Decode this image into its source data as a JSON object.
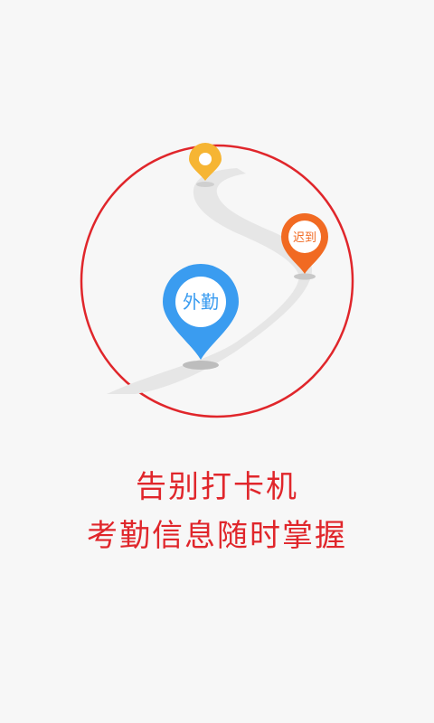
{
  "illustration": {
    "pins": [
      {
        "id": "top",
        "label": "",
        "color": "#f6b533"
      },
      {
        "id": "late",
        "label": "迟到",
        "color": "#f16a22"
      },
      {
        "id": "field",
        "label": "外勤",
        "color": "#3a9cf0"
      }
    ],
    "ring_color": "#e0262b",
    "road_color": "#e6e6e6"
  },
  "tagline": {
    "line1": "告别打卡机",
    "line2": "考勤信息随时掌握"
  }
}
